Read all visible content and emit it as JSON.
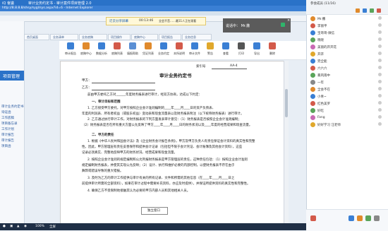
{
  "meeting_bar": {
    "app_title": "iQ 會議",
    "document_title": "审计业务约定书 - 审计案件项目管理 2.0",
    "meeting_code": "迁云分享屏幕",
    "timer": "00:13:46",
    "notice": "全会不音……最11人正在观看"
  },
  "browser_bar": {
    "address": "http://8.8.8.8/shsy/sygl/sys.aspx?id=6 - Internet Explorer"
  },
  "chat_popup": {
    "text": "说话中：  Mr.撒",
    "close": "×"
  },
  "sidebar": {
    "header": "项目管理",
    "items": [
      "审计业务约定书",
      "询证函",
      "工作底稿",
      "项目备忘录",
      "工作计划",
      "审计报告",
      "审计报告",
      "项目函"
    ]
  },
  "tabs": [
    "首页桌面",
    "业务清单",
    "业务底稿",
    "项目操作",
    "底稿中心",
    "项目报告",
    "业务信息"
  ],
  "toolbar": {
    "items": [
      {
        "label": "审计报告",
        "color": "#3a7fd4"
      },
      {
        "label": "底稿中心",
        "color": "#e08a2c"
      },
      {
        "label": "数据分析",
        "color": "#3a7fd4"
      },
      {
        "label": "底稿列表",
        "color": "#d35a4a"
      },
      {
        "label": "填报帮助",
        "color": "#5a8fd4"
      },
      {
        "label": "凭证列表",
        "color": "#e08a2c"
      },
      {
        "label": "业务约定",
        "color": "#3a7fd4"
      },
      {
        "label": "本所说明",
        "color": "#d35a4a"
      },
      {
        "label": "审计文件",
        "color": "#3a7fd4"
      },
      {
        "label": "警告",
        "color": "#e0a82c"
      },
      {
        "label": "查看",
        "color": "#3a7fd4"
      },
      {
        "label": "打印",
        "color": "#555555"
      },
      {
        "label": "导出",
        "color": "#3a7fd4"
      },
      {
        "label": "删除",
        "color": "#d35a4a"
      }
    ]
  },
  "document": {
    "ref_label": "索引号",
    "ref_value": "AA-4",
    "title": "审计业务约定书",
    "party_a": "甲方：",
    "party_b": "乙方：",
    "intro": "兹由甲方委托乙方对______年度财务报表进行审计，经双方协商，达成以下约定：",
    "sec1": "一、审计目标和范围",
    "p1": "1. 乙方接受甲方委托，对甲方按照企业会计准则编制的____年____月____日的资产负债表、",
    "p1b": "年度的利润表、所有者权益（或股东权益）变动表和现金流量表以及财务报表附注（以下统称财务报表）进行审计。",
    "p2": "2. 乙方通过执行审计工作，对财务报表的下列方面发表审计意见：（1）财务报表是否按照企业会计准则编制；",
    "p2b": "（2）财务报表是否在所有重大方面公允反映了甲方____年____月____日的财务状况以及____年度的经营成果和现金流量。",
    "sec2": "二、甲方的责任",
    "p3": "1. 根据《中华人民共和国会计法》及《企业财务会计报告条例》，甲方及甲方负责人有责任保证会计资料的真实性和完整",
    "p3b": "性。因此，甲方管理层有责任妥善保存和提供会计记录（包括但不限于会计凭证、会计账簿及其他会计资料），这些",
    "p3c": "记录必须真实、完整地反映甲方的财务状况、经营成果和现金流量。",
    "p4": "2. 按照企业会计准则的规定编制和公允列报财务报表是甲方管理层的责任，这种责任包括：（1）按照企业会计准则",
    "p4b": "规定编制财务报表，并使其实现公允反映；（2）设计、执行和维护必要的内部控制，以使财务报表不存在由于",
    "p4c": "舞弊或错误导致的重大错报。",
    "p5": "3. 及时为乙方的审计工作提供与审计有关的所有记录、文件和所需的其他信息（在____年____月____日之",
    "p5b": "前提供审计所需的全部资料），如果在审计过程中需要补充资料，亦应及时提供），并保证所提供资料的真实性和完整性。",
    "p6": "4. 确保乙方不受限制地接触其认为必要的甲方内部人员和其他相关人员。"
  },
  "window_chip": {
    "label": "独立窗口"
  },
  "status_bar": {
    "zoom": "100%",
    "hint": "全屏"
  },
  "right_panel": {
    "header": "参会成员 (11/16)",
    "members": [
      {
        "name": "Mr.撒",
        "color": "#e08a2c"
      },
      {
        "name": "李丽平",
        "color": "#d35a4a"
      },
      {
        "name": "宝哥哥-微信",
        "color": "#3a7fd4"
      },
      {
        "name": "晓晓",
        "color": "#5aa45a"
      },
      {
        "name": "美丽的开开花",
        "color": "#c96ab4"
      },
      {
        "name": "开开",
        "color": "#e0a82c"
      },
      {
        "name": "完全能",
        "color": "#3a7fd4"
      },
      {
        "name": "六六六",
        "color": "#d35a4a"
      },
      {
        "name": "暴风雨中",
        "color": "#5aa45a"
      },
      {
        "name": "一年",
        "color": "#888888"
      },
      {
        "name": "全会不在",
        "color": "#e08a2c"
      },
      {
        "name": "小青~",
        "color": "#3a7fd4"
      },
      {
        "name": "红色美罗",
        "color": "#d35a4a"
      },
      {
        "name": "好吃",
        "color": "#5aa45a"
      },
      {
        "name": "Fang",
        "color": "#c96ab4"
      },
      {
        "name": "好好学习 汪老师",
        "color": "#e0a82c"
      }
    ]
  }
}
